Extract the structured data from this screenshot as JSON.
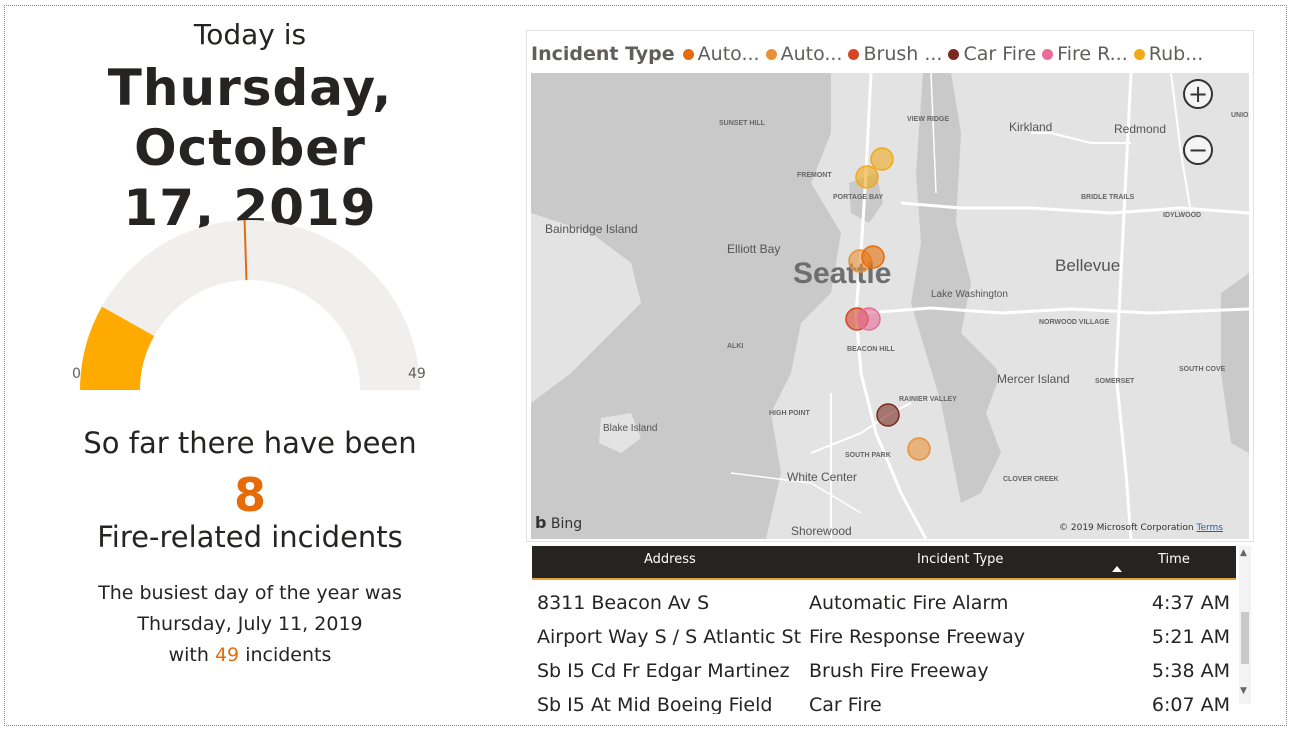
{
  "header": {
    "today_label": "Today is",
    "date_line1": "Thursday, October",
    "date_line2": "17, 2019"
  },
  "gauge": {
    "value": 8,
    "min": 0,
    "max": 49,
    "target": 24,
    "min_label": "0",
    "max_label": "49",
    "fill_color": "#ffaa00",
    "track_color": "#f0efee",
    "target_color": "#e66c0a"
  },
  "summary": {
    "so_far": "So far there have been",
    "count": "8",
    "fire_related": "Fire-related incidents",
    "busiest_label": "The busiest day of the year was",
    "busiest_date": "Thursday, July 11, 2019",
    "with_label": "with",
    "busiest_count": "49",
    "incidents_label": "incidents",
    "accent_color": "#e66c0a"
  },
  "map": {
    "legend_title": "Incident Type",
    "legend": [
      {
        "label": "Auto...",
        "color": "#e66c0a"
      },
      {
        "label": "Auto...",
        "color": "#e8913a"
      },
      {
        "label": "Brush ...",
        "color": "#d64525"
      },
      {
        "label": "Car Fire",
        "color": "#7a2a1f"
      },
      {
        "label": "Fire R...",
        "color": "#e66c9a"
      },
      {
        "label": "Rub...",
        "color": "#f0a81c"
      }
    ],
    "zoom_in_label": "+",
    "zoom_out_label": "−",
    "bing_label": "Bing",
    "copyright": "© 2019 Microsoft Corporation",
    "terms": "Terms",
    "labels": [
      {
        "text": "Seattle",
        "cls": "big"
      },
      {
        "text": "Bellevue",
        "cls": "mid"
      },
      {
        "text": "Kirkland",
        "cls": "sm"
      },
      {
        "text": "Redmond",
        "cls": "sm"
      },
      {
        "text": "Bainbridge Island",
        "cls": "sm"
      },
      {
        "text": "Elliott Bay",
        "cls": "sm"
      },
      {
        "text": "Lake Washington",
        "cls": "xs"
      },
      {
        "text": "Mercer Island",
        "cls": "sm"
      },
      {
        "text": "White Center",
        "cls": "sm"
      },
      {
        "text": "Shorewood",
        "cls": "sm"
      },
      {
        "text": "Blake Island",
        "cls": "xs"
      },
      {
        "text": "SUNSET HILL",
        "cls": "tiny"
      },
      {
        "text": "VIEW RIDGE",
        "cls": "tiny"
      },
      {
        "text": "FREMONT",
        "cls": "tiny"
      },
      {
        "text": "PORTAGE BAY",
        "cls": "tiny"
      },
      {
        "text": "BRIDLE TRAILS",
        "cls": "tiny"
      },
      {
        "text": "IDYLWOOD",
        "cls": "tiny"
      },
      {
        "text": "UNION",
        "cls": "tiny"
      },
      {
        "text": "NORWOOD VILLAGE",
        "cls": "tiny"
      },
      {
        "text": "BEACON HILL",
        "cls": "tiny"
      },
      {
        "text": "ALKI",
        "cls": "tiny"
      },
      {
        "text": "HIGH POINT",
        "cls": "tiny"
      },
      {
        "text": "RAINIER VALLEY",
        "cls": "tiny"
      },
      {
        "text": "SOUTH PARK",
        "cls": "tiny"
      },
      {
        "text": "SOMERSET",
        "cls": "tiny"
      },
      {
        "text": "SOUTH COVE",
        "cls": "tiny"
      },
      {
        "text": "CLOVER CREEK",
        "cls": "tiny"
      }
    ],
    "incidents": [
      {
        "type": "Rubbish",
        "color": "#f0a81c"
      },
      {
        "type": "Rubbish",
        "color": "#f0a81c"
      },
      {
        "type": "Automatic Fire Alarm",
        "color": "#e8913a"
      },
      {
        "type": "Automatic Fire Alarm",
        "color": "#e66c0a"
      },
      {
        "type": "Brush Fire Freeway",
        "color": "#d64525"
      },
      {
        "type": "Fire Response Freeway",
        "color": "#e66c9a"
      },
      {
        "type": "Car Fire",
        "color": "#7a2a1f"
      },
      {
        "type": "Automatic",
        "color": "#e8913a"
      }
    ]
  },
  "table": {
    "columns": [
      "Address",
      "Incident Type",
      "Time"
    ],
    "rows": [
      {
        "address": "8311 Beacon Av S",
        "type": "Automatic Fire Alarm",
        "time": "4:37 AM"
      },
      {
        "address": "Airport Way S / S Atlantic St",
        "type": "Fire Response Freeway",
        "time": "5:21 AM"
      },
      {
        "address": "Sb I5 Cd Fr Edgar Martinez",
        "type": "Brush Fire Freeway",
        "time": "5:38 AM"
      },
      {
        "address": "Sb I5 At Mid Boeing Field",
        "type": "Car Fire",
        "time": "6:07 AM"
      }
    ]
  }
}
